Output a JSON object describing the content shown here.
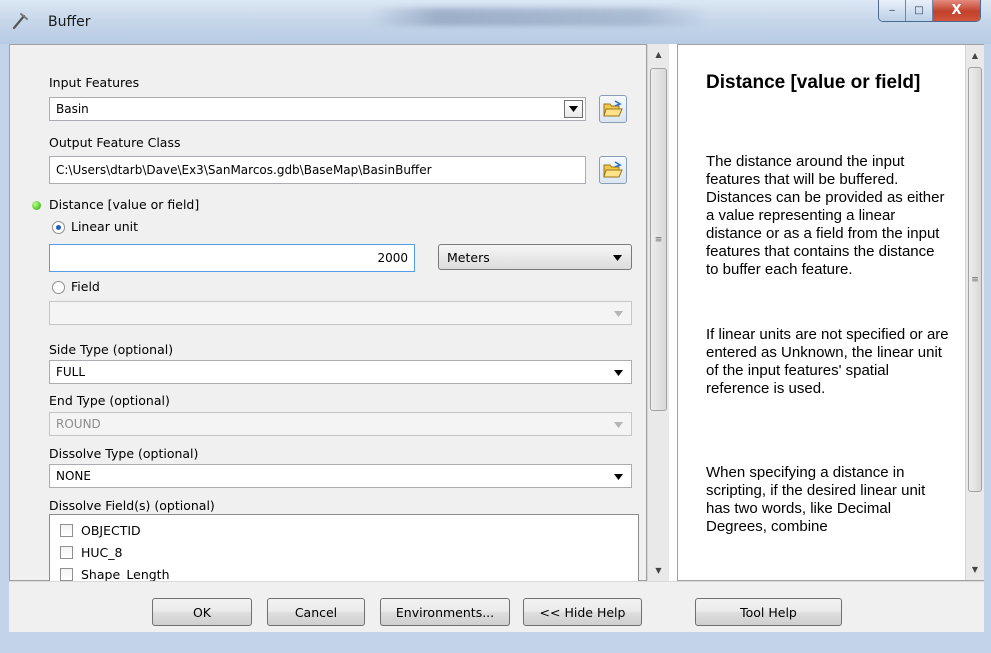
{
  "window": {
    "title": "Buffer",
    "minimize_label": "‒",
    "maximize_label": "□",
    "close_label": "X"
  },
  "form": {
    "input_features": {
      "label": "Input Features",
      "value": "Basin"
    },
    "output_feature_class": {
      "label": "Output Feature Class",
      "value": "C:\\Users\\dtarb\\Dave\\Ex3\\SanMarcos.gdb\\BaseMap\\BasinBuffer"
    },
    "distance": {
      "label": "Distance [value or field]",
      "linear_unit_label": "Linear unit",
      "linear_unit_selected": true,
      "value": "2000",
      "units": "Meters",
      "field_label": "Field",
      "field_value": ""
    },
    "side_type": {
      "label": "Side Type (optional)",
      "value": "FULL"
    },
    "end_type": {
      "label": "End Type (optional)",
      "value": "ROUND"
    },
    "dissolve_type": {
      "label": "Dissolve Type (optional)",
      "value": "NONE"
    },
    "dissolve_fields": {
      "label": "Dissolve Field(s) (optional)",
      "items": [
        {
          "label": "OBJECTID",
          "checked": false
        },
        {
          "label": "HUC_8",
          "checked": false
        },
        {
          "label": "Shape_Length",
          "checked": false
        }
      ]
    }
  },
  "help": {
    "title": "Distance [value or field]",
    "paragraphs": [
      "The distance around the input features that will be buffered. Distances can be provided as either a value representing a linear distance or as a field from the input features that contains the distance to buffer each feature.",
      "If linear units are not specified or are entered as Unknown, the linear unit of the input features' spatial reference is used.",
      "When specifying a distance in scripting, if the desired linear unit has two words, like Decimal Degrees, combine"
    ]
  },
  "buttons": {
    "ok": "OK",
    "cancel": "Cancel",
    "environments": "Environments...",
    "hide_help": "<< Hide Help",
    "tool_help": "Tool Help"
  },
  "colors": {
    "titlebar": "#c6d6ea",
    "close_button": "#c2412b",
    "required_indicator": "#22a500"
  }
}
